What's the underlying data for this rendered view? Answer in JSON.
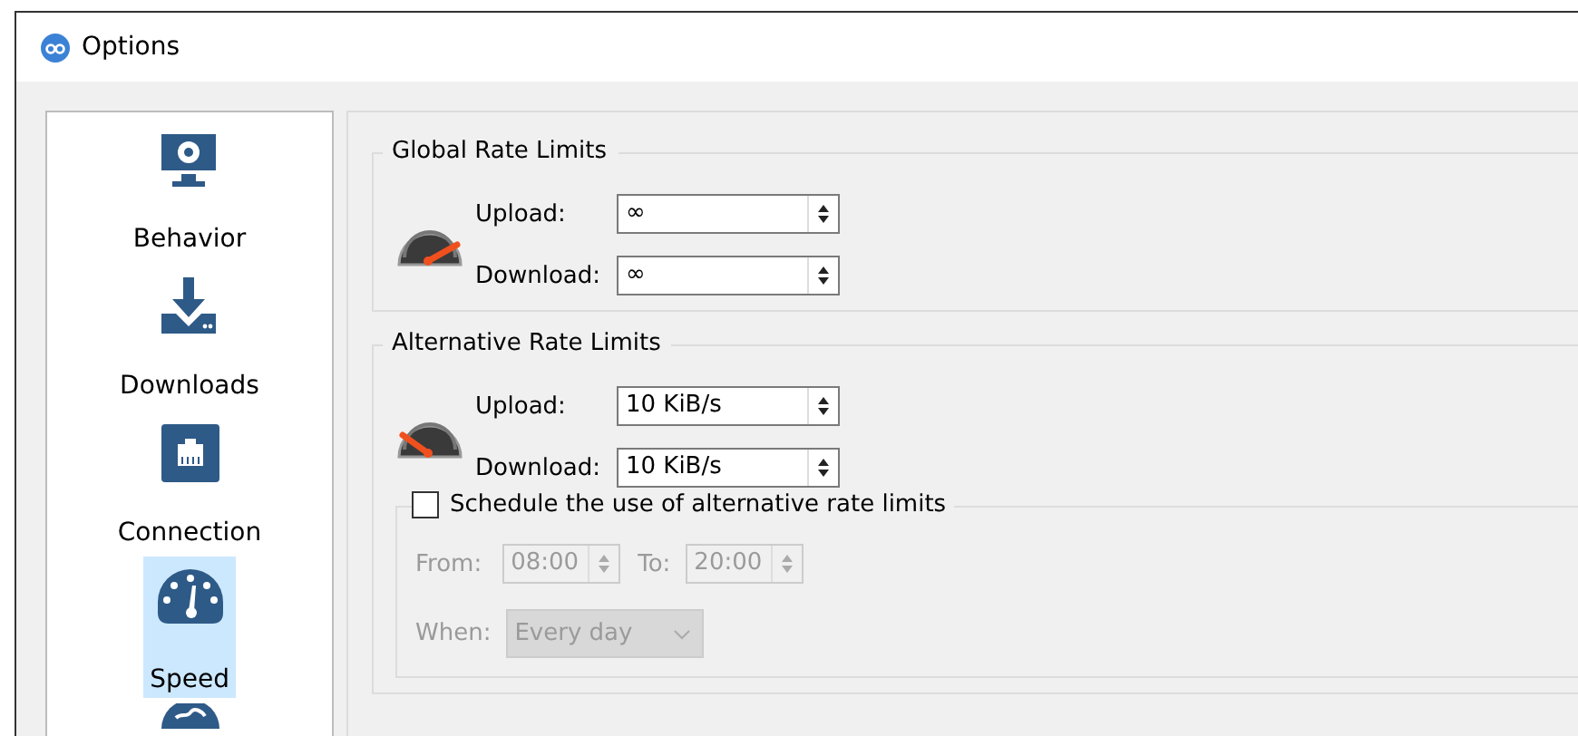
{
  "window": {
    "title": "Options"
  },
  "sidebar": {
    "items": [
      {
        "label": "Behavior",
        "kind": "monitor",
        "selected": false
      },
      {
        "label": "Downloads",
        "kind": "download",
        "selected": false
      },
      {
        "label": "Connection",
        "kind": "ethernet",
        "selected": false
      },
      {
        "label": "Speed",
        "kind": "speedometer",
        "selected": true
      }
    ]
  },
  "global_rate_limits": {
    "title": "Global Rate Limits",
    "fields": [
      {
        "label": "Upload:",
        "value": "∞"
      },
      {
        "label": "Download:",
        "value": "∞"
      }
    ]
  },
  "alternative_rate_limits": {
    "title": "Alternative Rate Limits",
    "fields": [
      {
        "label": "Upload:",
        "value": "10 KiB/s"
      },
      {
        "label": "Download:",
        "value": "10 KiB/s"
      }
    ],
    "schedule": {
      "label": "Schedule the use of alternative rate limits",
      "checked": false,
      "from": {
        "label": "From:",
        "value": "08:00",
        "disabled": true
      },
      "to": {
        "label": "To:",
        "value": "20:00",
        "disabled": true
      },
      "when": {
        "label": "When:",
        "value": "Every day",
        "disabled": true
      }
    }
  }
}
